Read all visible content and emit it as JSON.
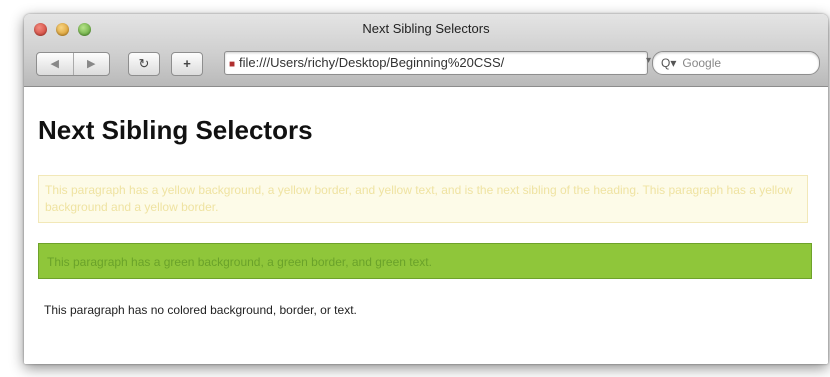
{
  "window": {
    "title": "Next Sibling Selectors"
  },
  "toolbar": {
    "back_label": "◀",
    "forward_label": "▶",
    "reload_label": "↻",
    "add_label": "+",
    "url": "file:///Users/richy/Desktop/Beginning%20CSS/",
    "search_placeholder": "Google"
  },
  "page": {
    "heading": "Next Sibling Selectors",
    "paragraph_yellow": "This paragraph has a yellow background, a yellow border, and yellow text, and is the next sibling of the heading. This paragraph has a yellow background and a yellow border.",
    "paragraph_green": "This paragraph has a green background, a green border, and green text.",
    "paragraph_plain": "This paragraph has no colored background, border, or text."
  },
  "colors": {
    "yellow_bg": "#fdfbe8",
    "green_bg": "#8fc63a"
  }
}
